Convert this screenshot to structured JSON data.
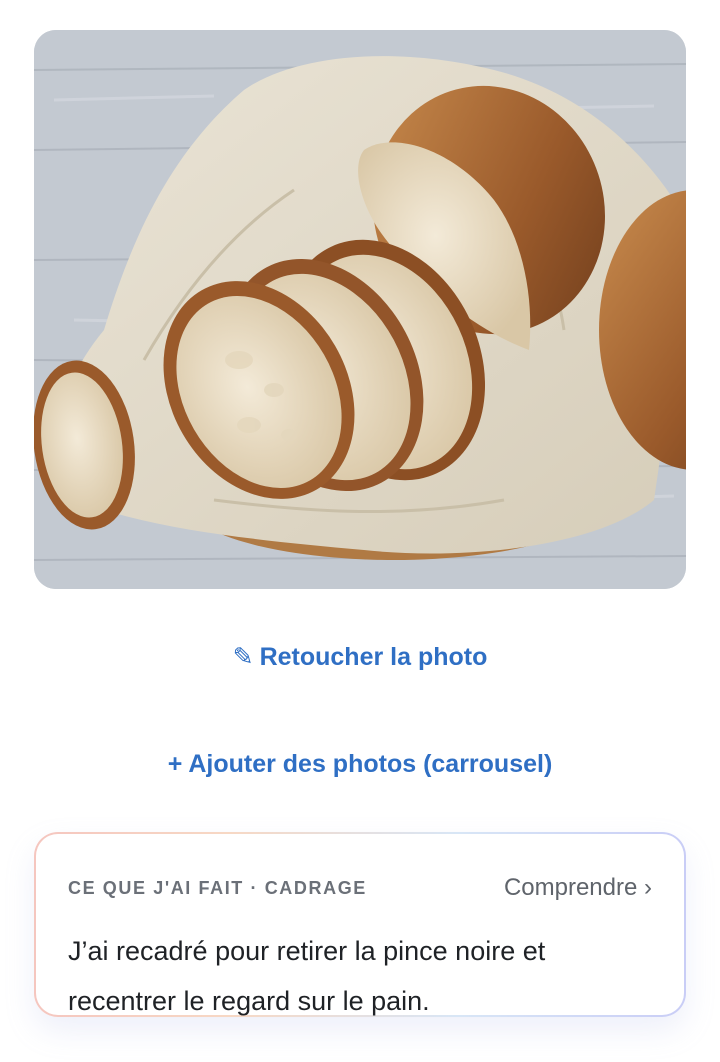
{
  "actions": {
    "retouch_icon": "✎",
    "retouch_label": "Retoucher la photo",
    "add_photos_label": "+ Ajouter des photos (carrousel)"
  },
  "info_card": {
    "tag": "CE QUE J'AI FAIT · CADRAGE",
    "link_label": "Comprendre ›",
    "body": "J’ai recadré pour retirer la pince noire et recentrer le regard sur le pain."
  },
  "colors": {
    "accent_link": "#2f6fc4",
    "card_gradient_start": "#f5c6bf",
    "card_gradient_end": "#c9cdf6"
  },
  "icons": {
    "retouch": "pencil-icon"
  }
}
